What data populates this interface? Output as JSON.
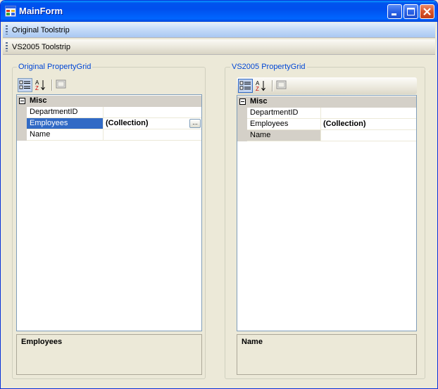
{
  "window": {
    "title": "MainForm"
  },
  "toolstrips": [
    {
      "label": "Original Toolstrip"
    },
    {
      "label": "VS2005 Toolstrip"
    }
  ],
  "left_panel": {
    "group_title": "Original PropertyGrid",
    "category": "Misc",
    "properties": [
      {
        "name": "DepartmentID",
        "value": ""
      },
      {
        "name": "Employees",
        "value": "(Collection)"
      },
      {
        "name": "Name",
        "value": ""
      }
    ],
    "ellipsis_label": "...",
    "description_title": "Employees"
  },
  "right_panel": {
    "group_title": "VS2005 PropertyGrid",
    "category": "Misc",
    "properties": [
      {
        "name": "DepartmentID",
        "value": ""
      },
      {
        "name": "Employees",
        "value": "(Collection)"
      },
      {
        "name": "Name",
        "value": ""
      }
    ],
    "description_title": "Name"
  }
}
